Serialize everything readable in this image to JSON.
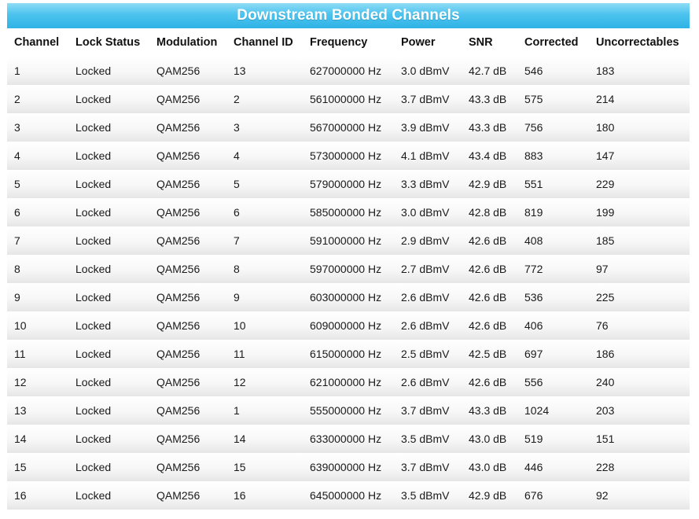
{
  "title": "Downstream Bonded Channels",
  "columns": [
    "Channel",
    "Lock Status",
    "Modulation",
    "Channel ID",
    "Frequency",
    "Power",
    "SNR",
    "Corrected",
    "Uncorrectables"
  ],
  "rows": [
    [
      "1",
      "Locked",
      "QAM256",
      "13",
      "627000000 Hz",
      "3.0 dBmV",
      "42.7 dB",
      "546",
      "183"
    ],
    [
      "2",
      "Locked",
      "QAM256",
      "2",
      "561000000 Hz",
      "3.7 dBmV",
      "43.3 dB",
      "575",
      "214"
    ],
    [
      "3",
      "Locked",
      "QAM256",
      "3",
      "567000000 Hz",
      "3.9 dBmV",
      "43.3 dB",
      "756",
      "180"
    ],
    [
      "4",
      "Locked",
      "QAM256",
      "4",
      "573000000 Hz",
      "4.1 dBmV",
      "43.4 dB",
      "883",
      "147"
    ],
    [
      "5",
      "Locked",
      "QAM256",
      "5",
      "579000000 Hz",
      "3.3 dBmV",
      "42.9 dB",
      "551",
      "229"
    ],
    [
      "6",
      "Locked",
      "QAM256",
      "6",
      "585000000 Hz",
      "3.0 dBmV",
      "42.8 dB",
      "819",
      "199"
    ],
    [
      "7",
      "Locked",
      "QAM256",
      "7",
      "591000000 Hz",
      "2.9 dBmV",
      "42.6 dB",
      "408",
      "185"
    ],
    [
      "8",
      "Locked",
      "QAM256",
      "8",
      "597000000 Hz",
      "2.7 dBmV",
      "42.6 dB",
      "772",
      "97"
    ],
    [
      "9",
      "Locked",
      "QAM256",
      "9",
      "603000000 Hz",
      "2.6 dBmV",
      "42.6 dB",
      "536",
      "225"
    ],
    [
      "10",
      "Locked",
      "QAM256",
      "10",
      "609000000 Hz",
      "2.6 dBmV",
      "42.6 dB",
      "406",
      "76"
    ],
    [
      "11",
      "Locked",
      "QAM256",
      "11",
      "615000000 Hz",
      "2.5 dBmV",
      "42.5 dB",
      "697",
      "186"
    ],
    [
      "12",
      "Locked",
      "QAM256",
      "12",
      "621000000 Hz",
      "2.6 dBmV",
      "42.6 dB",
      "556",
      "240"
    ],
    [
      "13",
      "Locked",
      "QAM256",
      "1",
      "555000000 Hz",
      "3.7 dBmV",
      "43.3 dB",
      "1024",
      "203"
    ],
    [
      "14",
      "Locked",
      "QAM256",
      "14",
      "633000000 Hz",
      "3.5 dBmV",
      "43.0 dB",
      "519",
      "151"
    ],
    [
      "15",
      "Locked",
      "QAM256",
      "15",
      "639000000 Hz",
      "3.7 dBmV",
      "43.0 dB",
      "446",
      "228"
    ],
    [
      "16",
      "Locked",
      "QAM256",
      "16",
      "645000000 Hz",
      "3.5 dBmV",
      "42.9 dB",
      "676",
      "92"
    ]
  ],
  "colors": {
    "title_bar": "#4cc3ee",
    "title_text": "#ffffff"
  }
}
